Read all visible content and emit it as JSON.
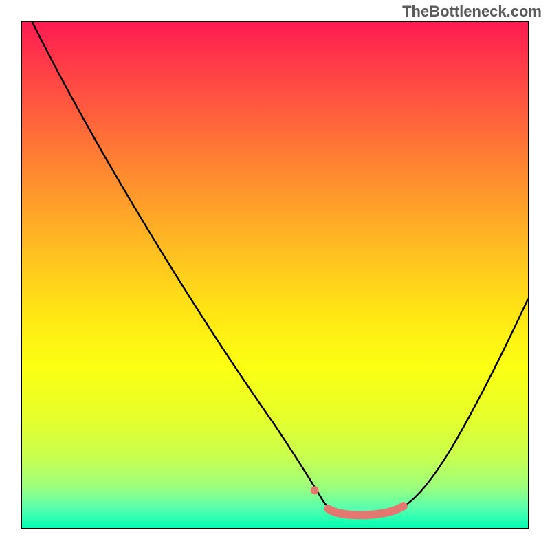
{
  "watermark": "TheBottleneck.com",
  "chart_data": {
    "type": "line",
    "title": "",
    "xlabel": "",
    "ylabel": "",
    "xlim": [
      0,
      100
    ],
    "ylim": [
      0,
      100
    ],
    "grid": false,
    "legend": false,
    "series": [
      {
        "name": "bottleneck-curve",
        "color": "#000000",
        "x": [
          2,
          10,
          20,
          30,
          40,
          50,
          55,
          58,
          61,
          65,
          70,
          75,
          80,
          90,
          100
        ],
        "y": [
          100,
          87,
          72,
          57,
          42,
          27,
          17,
          10,
          5,
          3,
          3,
          4,
          8,
          22,
          45
        ]
      },
      {
        "name": "highlight-segment",
        "color": "#e27870",
        "x": [
          58,
          61,
          65,
          70,
          75
        ],
        "y": [
          10,
          5,
          3,
          3,
          4
        ]
      }
    ],
    "background_gradient": {
      "orientation": "vertical",
      "stops": [
        {
          "pos": 0.0,
          "color": "#ff1b52"
        },
        {
          "pos": 0.5,
          "color": "#ffc81e"
        },
        {
          "pos": 0.8,
          "color": "#e6ff2b"
        },
        {
          "pos": 1.0,
          "color": "#00ffb4"
        }
      ]
    }
  }
}
